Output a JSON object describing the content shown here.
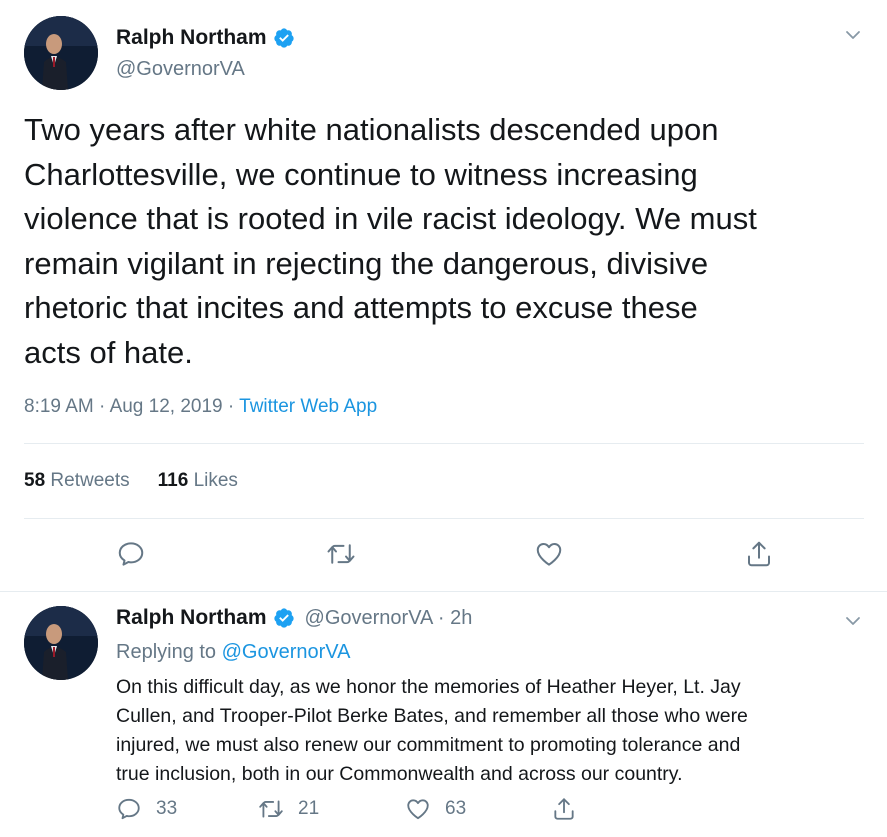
{
  "main_tweet": {
    "display_name": "Ralph Northam",
    "handle": "@GovernorVA",
    "text": "Two years after white nationalists descended upon\nCharlottesville, we continue to witness increasing\nviolence that is rooted in vile racist ideology. We must\nremain vigilant in rejecting the dangerous, divisive\nrhetoric that incites and attempts to excuse these\nacts of hate.",
    "time": "8:19 AM",
    "date": "Aug 12, 2019",
    "separator": "·",
    "source": "Twitter Web App",
    "retweet_count": "58",
    "retweet_label": "Retweets",
    "like_count": "116",
    "like_label": "Likes"
  },
  "reply_tweet": {
    "display_name": "Ralph Northam",
    "handle": "@GovernorVA",
    "separator": "·",
    "age": "2h",
    "replying_prefix": "Replying to",
    "replying_to": "@GovernorVA",
    "text": "On this difficult day, as we honor the memories of Heather Heyer, Lt. Jay\nCullen, and Trooper-Pilot Berke Bates, and remember all those who were\ninjured, we must also renew our commitment to promoting tolerance and\ntrue inclusion, both in our Commonwealth and across our country.",
    "reply_count": "33",
    "retweet_count": "21",
    "like_count": "63"
  },
  "icons": {
    "verified": "verified-badge-icon",
    "caret": "chevron-down-icon",
    "reply": "reply-icon",
    "retweet": "retweet-icon",
    "like": "heart-icon",
    "share": "share-icon"
  },
  "colors": {
    "text": "#14171a",
    "secondary": "#657786",
    "link": "#1b95e0",
    "verified": "#1da1f2",
    "divider": "#e6ecf0"
  }
}
